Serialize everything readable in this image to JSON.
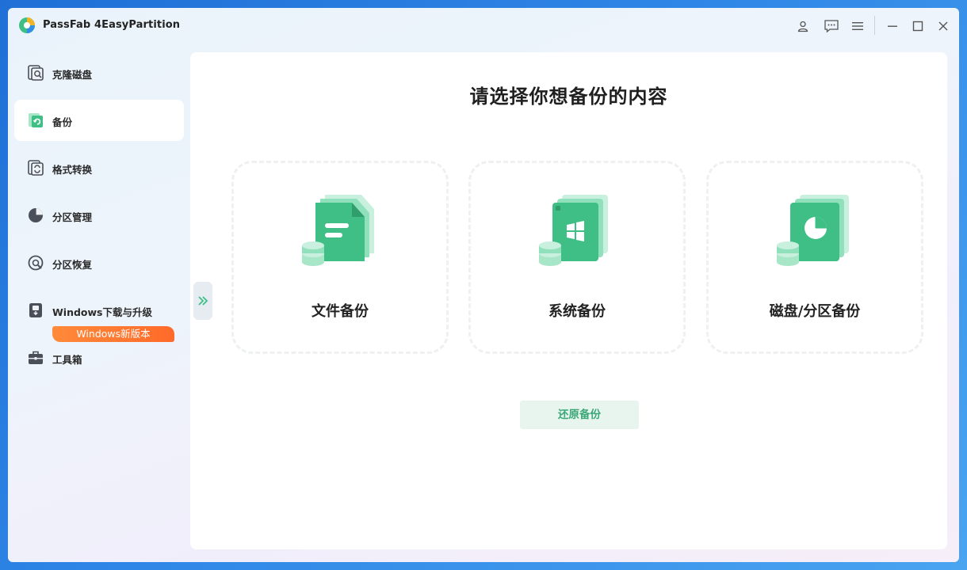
{
  "app": {
    "title": "PassFab 4EasyPartition"
  },
  "titlebar": {
    "icons": [
      "account-icon",
      "feedback-icon",
      "menu-icon",
      "minimize-icon",
      "maximize-icon",
      "close-icon"
    ]
  },
  "sidebar": {
    "items": [
      {
        "label": "克隆磁盘",
        "icon": "clone-disk-icon",
        "active": false
      },
      {
        "label": "备份",
        "icon": "backup-icon",
        "active": true
      },
      {
        "label": "格式转换",
        "icon": "format-convert-icon",
        "active": false
      },
      {
        "label": "分区管理",
        "icon": "partition-manage-icon",
        "active": false
      },
      {
        "label": "分区恢复",
        "icon": "partition-recovery-icon",
        "active": false
      },
      {
        "label": "Windows下载与升级",
        "icon": "windows-download-icon",
        "active": false,
        "badge": "Windows新版本"
      },
      {
        "label": "工具箱",
        "icon": "toolbox-icon",
        "active": false
      }
    ]
  },
  "main": {
    "title": "请选择你想备份的内容",
    "cards": [
      {
        "label": "文件备份",
        "icon": "file-backup-icon"
      },
      {
        "label": "系统备份",
        "icon": "system-backup-icon"
      },
      {
        "label": "磁盘/分区备份",
        "icon": "disk-partition-backup-icon"
      }
    ],
    "restore_label": "还原备份"
  },
  "colors": {
    "accent": "#3fbf86",
    "badge": "#ff7a30",
    "restore_bg": "#e7f5ee",
    "restore_text": "#3aa776"
  }
}
